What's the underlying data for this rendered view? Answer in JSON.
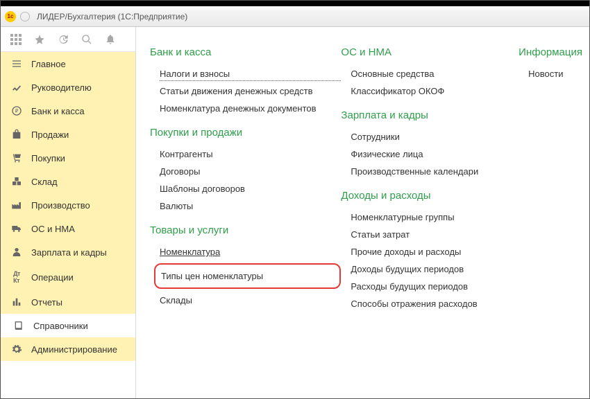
{
  "window": {
    "title": "ЛИДЕР/Бухгалтерия (1С:Предприятие)",
    "logo_text": "1с"
  },
  "sidebar": {
    "items": [
      {
        "label": "Главное"
      },
      {
        "label": "Руководителю"
      },
      {
        "label": "Банк и касса"
      },
      {
        "label": "Продажи"
      },
      {
        "label": "Покупки"
      },
      {
        "label": "Склад"
      },
      {
        "label": "Производство"
      },
      {
        "label": "ОС и НМА"
      },
      {
        "label": "Зарплата и кадры"
      },
      {
        "label": "Операции"
      },
      {
        "label": "Отчеты"
      },
      {
        "label": "Справочники"
      },
      {
        "label": "Администрирование"
      }
    ]
  },
  "content": {
    "col1": {
      "s0": {
        "title": "Банк и касса",
        "links": [
          "Налоги и взносы",
          "Статьи движения денежных средств",
          "Номенклатура денежных документов"
        ]
      },
      "s1": {
        "title": "Покупки и продажи",
        "links": [
          "Контрагенты",
          "Договоры",
          "Шаблоны договоров",
          "Валюты"
        ]
      },
      "s2": {
        "title": "Товары и услуги",
        "links": [
          "Номенклатура",
          "Типы цен номенклатуры",
          "Склады"
        ]
      }
    },
    "col2": {
      "s0": {
        "title": "ОС и НМА",
        "links": [
          "Основные средства",
          "Классификатор ОКОФ"
        ]
      },
      "s1": {
        "title": "Зарплата и кадры",
        "links": [
          "Сотрудники",
          "Физические лица",
          "Производственные календари"
        ]
      },
      "s2": {
        "title": "Доходы и расходы",
        "links": [
          "Номенклатурные группы",
          "Статьи затрат",
          "Прочие доходы и расходы",
          "Доходы будущих периодов",
          "Расходы будущих периодов",
          "Способы отражения расходов"
        ]
      }
    },
    "col3": {
      "s0": {
        "title": "Информация",
        "links": [
          "Новости"
        ]
      }
    }
  }
}
